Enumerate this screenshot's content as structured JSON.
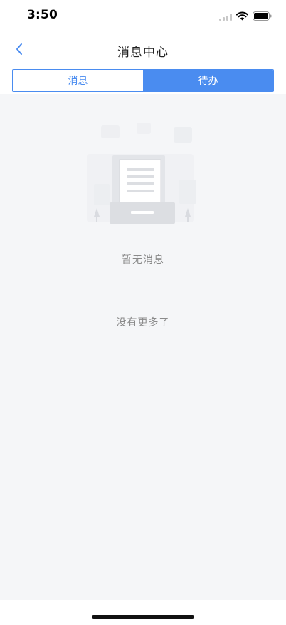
{
  "status_bar": {
    "time": "3:50"
  },
  "header": {
    "title": "消息中心",
    "back_icon": "chevron-left-icon"
  },
  "tabs": [
    {
      "label": "消息",
      "active": false
    },
    {
      "label": "待办",
      "active": true
    }
  ],
  "main": {
    "empty_icon": "empty-document-icon",
    "empty_text": "暂无消息",
    "no_more_text": "没有更多了"
  },
  "colors": {
    "accent": "#4a8cf0",
    "background": "#f5f6f8",
    "muted_text": "#8a8a8a"
  }
}
